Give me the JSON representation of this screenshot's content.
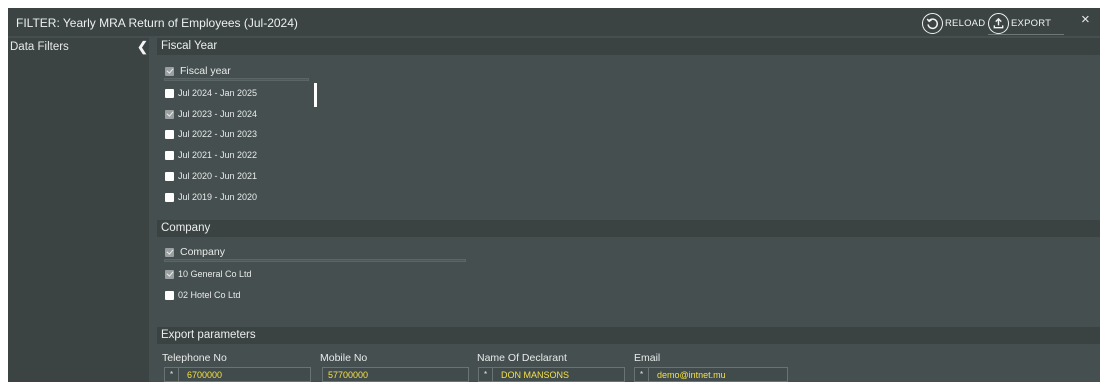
{
  "window": {
    "title": "FILTER: Yearly MRA Return of Employees (Jul-2024)",
    "reload_label": "RELOAD",
    "export_label": "EXPORT",
    "close_glyph": "×"
  },
  "sidebar": {
    "title": "Data Filters",
    "collapse_glyph": "❮"
  },
  "fiscal_year": {
    "title": "Fiscal Year",
    "master_label": "Fiscal year",
    "items": [
      {
        "label": "Jul 2024 - Jan 2025",
        "checked": false
      },
      {
        "label": "Jul 2023 - Jun 2024",
        "checked": true
      },
      {
        "label": "Jul 2022 - Jun 2023",
        "checked": false
      },
      {
        "label": "Jul 2021 - Jun 2022",
        "checked": false
      },
      {
        "label": "Jul 2020 - Jun 2021",
        "checked": false
      },
      {
        "label": "Jul 2019 - Jun 2020",
        "checked": false
      }
    ]
  },
  "company": {
    "title": "Company",
    "master_label": "Company",
    "items": [
      {
        "label": "10 General Co Ltd",
        "checked": true
      },
      {
        "label": "02 Hotel Co Ltd",
        "checked": false
      }
    ]
  },
  "export_params": {
    "title": "Export parameters",
    "telephone": {
      "label": "Telephone No",
      "value": "6700000",
      "required_mark": "*"
    },
    "mobile": {
      "label": "Mobile No",
      "value": "57700000"
    },
    "declarant": {
      "label": "Name Of Declarant",
      "value": "DON MANSONS",
      "required_mark": "*"
    },
    "email": {
      "label": "Email",
      "value": "demo@intnet.mu",
      "required_mark": "*"
    }
  },
  "colors": {
    "panel": "#464f4f",
    "sidebar": "#3b4343",
    "input_text": "#f2e04b"
  },
  "icons": {
    "reload": "reload-icon",
    "export": "upload-icon",
    "close": "close-icon",
    "collapse": "chevron-left-icon"
  }
}
